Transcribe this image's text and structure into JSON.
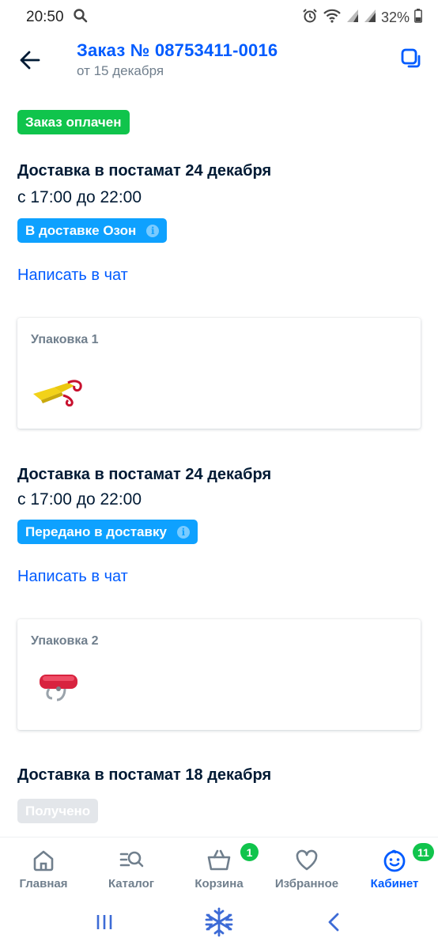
{
  "status_bar": {
    "time": "20:50",
    "battery": "32%"
  },
  "header": {
    "title": "Заказ № 08753411-0016",
    "subtitle": "от 15 декабря",
    "back_icon": "arrow-left-icon",
    "copy_icon": "copy-icon"
  },
  "order_status": "Заказ оплачен",
  "deliveries": [
    {
      "title": "Доставка в постамат 24 декабря",
      "time": "с 17:00 до 22:00",
      "status": "В доставке Озон",
      "chat_link": "Написать в чат",
      "package_label": "Упаковка 1"
    },
    {
      "title": "Доставка в постамат 24 декабря",
      "time": "с 17:00 до 22:00",
      "status": "Передано в доставку",
      "chat_link": "Написать в чат",
      "package_label": "Упаковка 2"
    },
    {
      "title": "Доставка в постамат 18 декабря",
      "status": "Получено"
    }
  ],
  "bottom_nav": [
    {
      "label": "Главная",
      "icon": "home-icon"
    },
    {
      "label": "Каталог",
      "icon": "catalog-search-icon"
    },
    {
      "label": "Корзина",
      "icon": "basket-icon",
      "count": "1"
    },
    {
      "label": "Избранное",
      "icon": "heart-icon"
    },
    {
      "label": "Кабинет",
      "icon": "smiley-icon",
      "count": "11",
      "active": true
    }
  ],
  "colors": {
    "accent": "#005bff",
    "green": "#10c44c",
    "info_blue": "#0ea1ff",
    "text": "#001a34",
    "muted": "#707f8d"
  }
}
